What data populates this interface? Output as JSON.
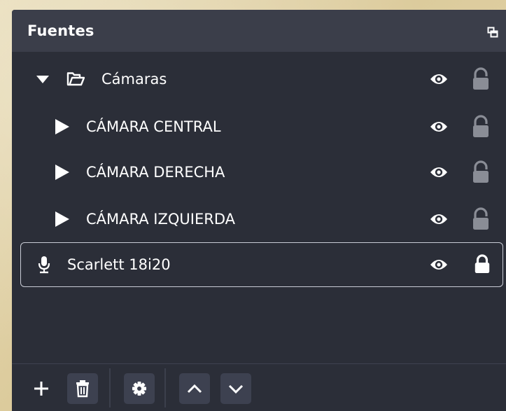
{
  "dock": {
    "title": "Fuentes",
    "undock_icon": "undock-icon"
  },
  "sources": [
    {
      "label": "Cámaras",
      "type": "folder",
      "expanded": true,
      "visible": true,
      "locked": false
    },
    {
      "label": "CÁMARA CENTRAL",
      "type": "group",
      "expanded": false,
      "visible": true,
      "locked": false
    },
    {
      "label": "CÁMARA DERECHA",
      "type": "group",
      "expanded": false,
      "visible": true,
      "locked": false
    },
    {
      "label": "CÁMARA IZQUIERDA",
      "type": "group",
      "expanded": false,
      "visible": true,
      "locked": false
    },
    {
      "label": "Scarlett 18i20",
      "type": "audio-input",
      "selected": true,
      "visible": true,
      "locked": true
    }
  ],
  "toolbar": {
    "icons": [
      "plus-icon",
      "trash-icon",
      "gear-icon",
      "chevron-up-icon",
      "chevron-down-icon"
    ]
  },
  "colors": {
    "panel": "#2b2e38",
    "titlebar": "#3b3e4a",
    "text": "#ffffff",
    "unlocked_icon": "#8a8d96",
    "locked_icon": "#ffffff",
    "selection_border": "#c9ccd6"
  }
}
